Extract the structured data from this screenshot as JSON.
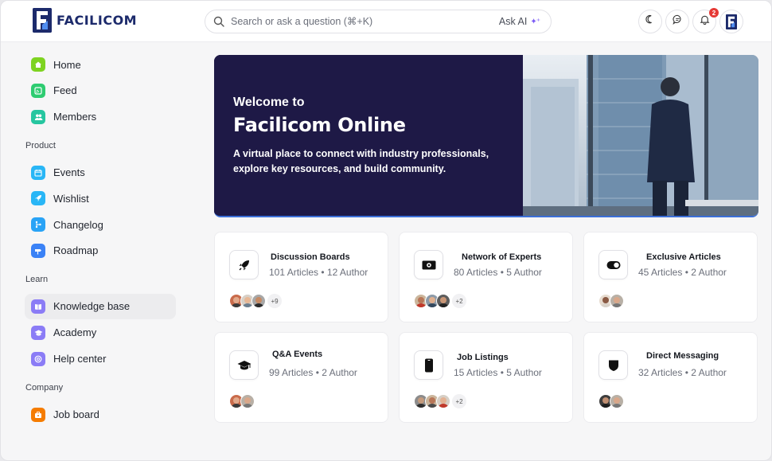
{
  "app": {
    "brand": "FACILICOM"
  },
  "header": {
    "search_placeholder": "Search or ask a question (⌘+K)",
    "ask_ai_label": "Ask AI",
    "ask_ai_icon": "sparkle-icon",
    "notification_count": "2"
  },
  "sidebar": {
    "top_items": [
      {
        "label": "Home",
        "icon": "home-icon",
        "color": "#7ed321"
      },
      {
        "label": "Feed",
        "icon": "rss-icon",
        "color": "#2ecc71"
      },
      {
        "label": "Members",
        "icon": "users-icon",
        "color": "#26c6a0"
      }
    ],
    "product_title": "Product",
    "product_items": [
      {
        "label": "Events",
        "icon": "calendar-icon",
        "color": "#29b6f6"
      },
      {
        "label": "Wishlist",
        "icon": "rocket-icon",
        "color": "#29b6f6"
      },
      {
        "label": "Changelog",
        "icon": "branch-icon",
        "color": "#29a3f6"
      },
      {
        "label": "Roadmap",
        "icon": "signpost-icon",
        "color": "#3b82f6"
      }
    ],
    "learn_title": "Learn",
    "learn_items": [
      {
        "label": "Knowledge base",
        "icon": "book-icon",
        "color": "#8b7cf6",
        "active": true
      },
      {
        "label": "Academy",
        "icon": "graduation-cap-icon",
        "color": "#8b7cf6"
      },
      {
        "label": "Help center",
        "icon": "lifebuoy-icon",
        "color": "#8b7cf6"
      }
    ],
    "company_title": "Company",
    "company_items": [
      {
        "label": "Job board",
        "icon": "briefcase-icon",
        "color": "#f57c00"
      }
    ]
  },
  "banner": {
    "kicker": "Welcome to",
    "title": "Facilicom Online",
    "description": "A virtual place to connect with industry professionals, explore key resources, and build community."
  },
  "cards": [
    {
      "title": "Discussion Boards",
      "subtitle": "101 Articles • 12 Author",
      "icon": "rocket-icon",
      "more": "+9"
    },
    {
      "title": "Network of Experts",
      "subtitle": "80 Articles • 5 Author",
      "icon": "banknote-icon",
      "more": "+2"
    },
    {
      "title": "Exclusive Articles",
      "subtitle": "45 Articles • 2 Author",
      "icon": "toggle-icon",
      "more": ""
    },
    {
      "title": "Q&A Events",
      "subtitle": "99 Articles • 2 Author",
      "icon": "graduation-cap-icon",
      "more": ""
    },
    {
      "title": "Job Listings",
      "subtitle": "15 Articles • 5 Author",
      "icon": "phone-icon",
      "more": "+2"
    },
    {
      "title": "Direct Messaging",
      "subtitle": "32 Articles • 2 Author",
      "icon": "shield-icon",
      "more": ""
    }
  ]
}
